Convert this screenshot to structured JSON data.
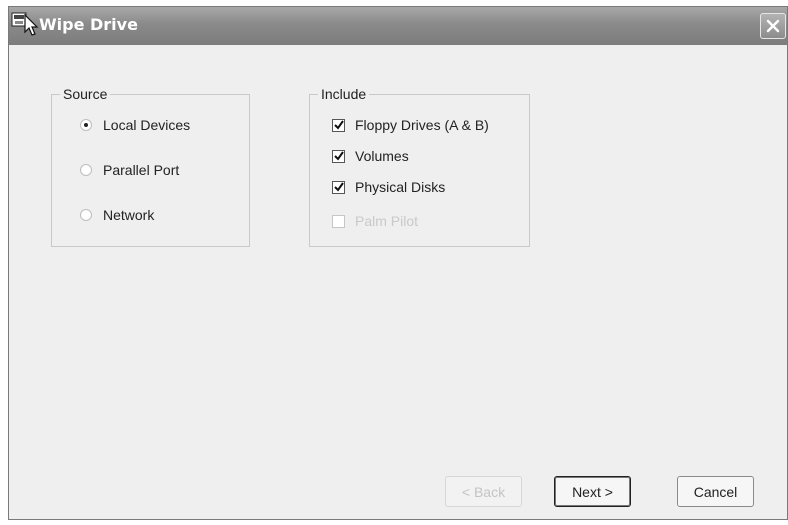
{
  "window": {
    "title": "Wipe Drive",
    "title_icon": "wipe-drive-app-icon",
    "close_icon": "close-icon"
  },
  "source": {
    "label": "Source",
    "options": [
      {
        "label": "Local Devices",
        "selected": true
      },
      {
        "label": "Parallel Port",
        "selected": false
      },
      {
        "label": "Network",
        "selected": false
      }
    ]
  },
  "include": {
    "label": "Include",
    "options": [
      {
        "label": "Floppy Drives (A & B)",
        "checked": true,
        "enabled": true
      },
      {
        "label": "Volumes",
        "checked": true,
        "enabled": true
      },
      {
        "label": "Physical Disks",
        "checked": true,
        "enabled": true
      },
      {
        "label": "Palm Pilot",
        "checked": false,
        "enabled": false
      }
    ]
  },
  "buttons": {
    "back": {
      "label": "< Back",
      "enabled": false
    },
    "next": {
      "label": "Next >",
      "enabled": true
    },
    "cancel": {
      "label": "Cancel",
      "enabled": true
    }
  }
}
